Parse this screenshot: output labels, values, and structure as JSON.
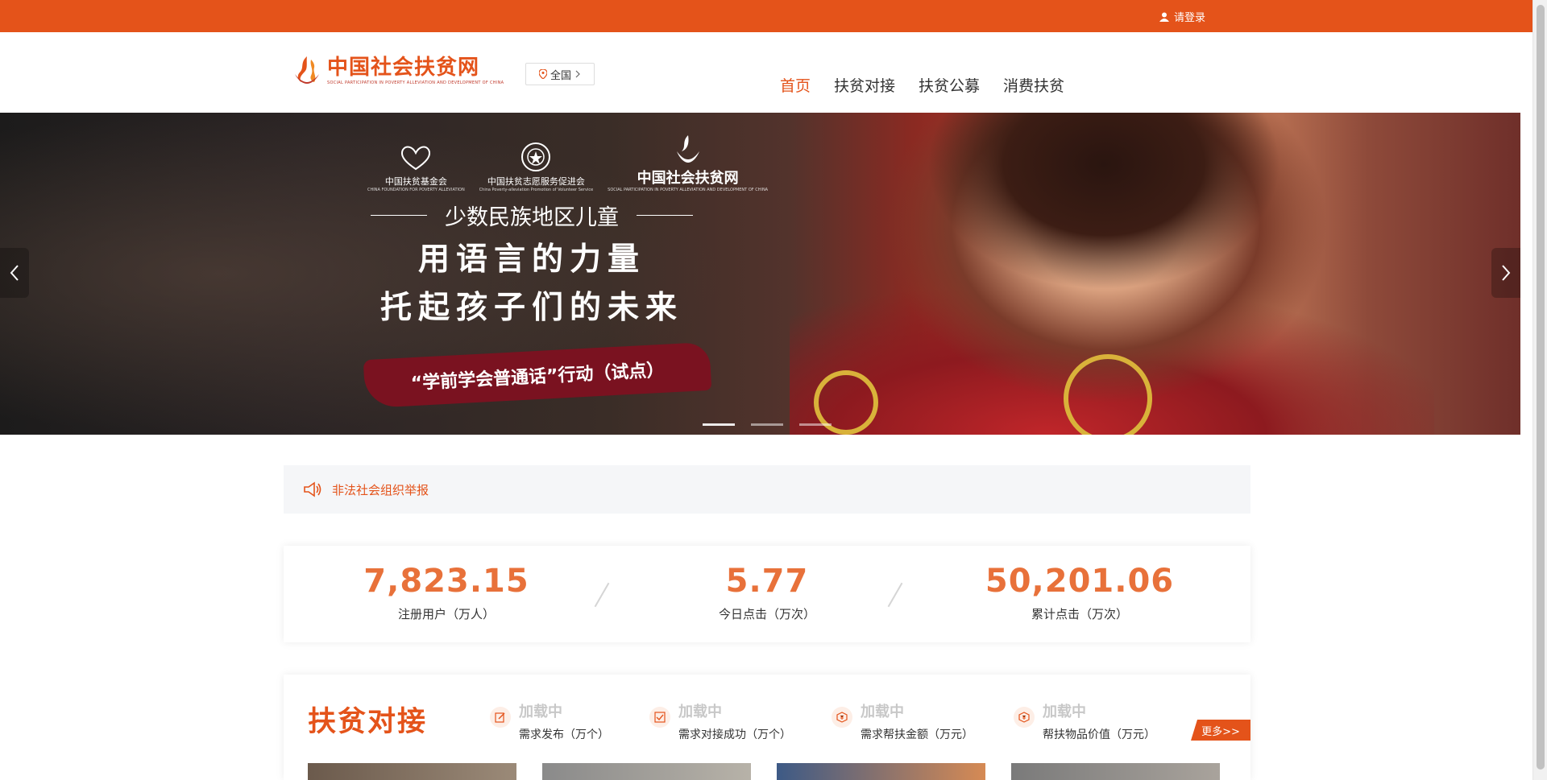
{
  "topbar": {
    "login_label": "请登录",
    "login_icon": "user-icon"
  },
  "header": {
    "logo_cn": "中国社会扶贫网",
    "logo_en": "SOCIAL PARTICIPATION IN POVERTY ALLEVIATION AND DEVELOPMENT OF CHINA",
    "region_label": "全国",
    "nav": [
      {
        "label": "首页",
        "active": true
      },
      {
        "label": "扶贫对接",
        "active": false
      },
      {
        "label": "扶贫公募",
        "active": false
      },
      {
        "label": "消费扶贫",
        "active": false
      }
    ]
  },
  "banner": {
    "orgs": [
      {
        "name": "中国扶贫基金会",
        "sub": "CHINA FOUNDATION FOR POVERTY ALLEVIATION"
      },
      {
        "name": "中国扶贫志愿服务促进会",
        "sub": "China Poverty-alleviation Promotion of Volunteer Service"
      },
      {
        "name": "中国社会扶贫网",
        "sub": "SOCIAL PARTICIPATION IN POVERTY ALLEVIATION AND DEVELOPMENT OF CHINA"
      }
    ],
    "subtitle": "少数民族地区儿童",
    "line1": "用语言的力量",
    "line2": "托起孩子们的未来",
    "campaign": "“学前学会普通话”行动（试点）",
    "slide_count": 3,
    "active_slide": 1
  },
  "notice": {
    "text": "非法社会组织举报",
    "icon": "megaphone-icon"
  },
  "stats": [
    {
      "value": "7,823.15",
      "label": "注册用户（万人）"
    },
    {
      "value": "5.77",
      "label": "今日点击（万次）"
    },
    {
      "value": "50,201.06",
      "label": "累计点击（万次）"
    }
  ],
  "match": {
    "title": "扶贫对接",
    "metrics": [
      {
        "value": "加载中",
        "label": "需求发布（万个）",
        "icon": "edit-icon"
      },
      {
        "value": "加载中",
        "label": "需求对接成功（万个）",
        "icon": "check-box-icon"
      },
      {
        "value": "加载中",
        "label": "需求帮扶金额（万元）",
        "icon": "money-icon"
      },
      {
        "value": "加载中",
        "label": "帮扶物品价值（万元）",
        "icon": "gift-icon"
      }
    ],
    "more_label": "更多>>"
  },
  "colors": {
    "brand": "#e4531a",
    "stat_number": "#e8713a",
    "notice_bg": "#f5f6f8"
  }
}
